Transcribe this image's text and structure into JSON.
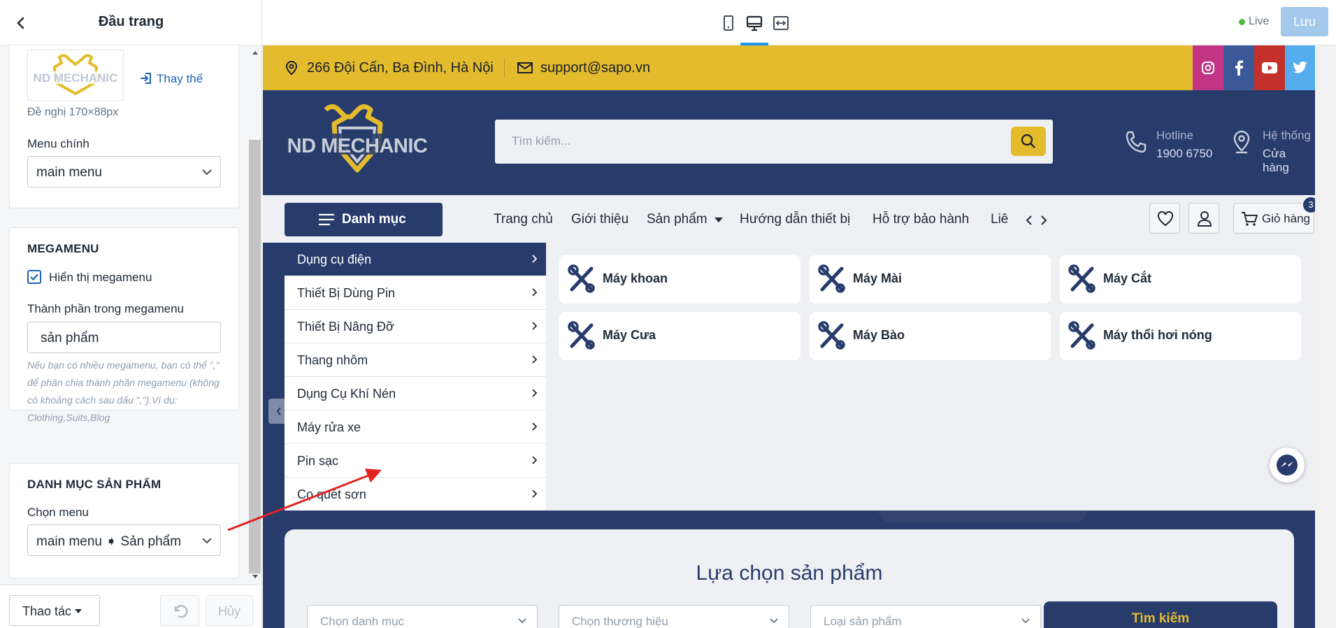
{
  "panel": {
    "title": "Đầu trang",
    "logo": {
      "replace_label": "Thay thế",
      "recommend": "Đề nghị 170×88px"
    },
    "main_menu": {
      "label": "Menu chính",
      "value": "main menu"
    },
    "megamenu": {
      "title": "MEGAMENU",
      "show_label": "Hiển thị megamenu",
      "show_checked": true,
      "components_label": "Thành phần trong megamenu",
      "components_value": "sản phẩm",
      "hint": "Nếu bạn có nhiều megamenu, bạn có thể \",\" để phân chia thành phần megamenu (không có khoảng cách sau dấu \",\").Ví dụ: Clothing,Suits,Blog"
    },
    "category": {
      "title": "DANH MỤC SẢN PHẨM",
      "menu_label": "Chọn menu",
      "menu_value": "main menu ➧ Sản phẩm"
    },
    "footer": {
      "actions": "Thao tác",
      "cancel": "Hủy"
    }
  },
  "toolbar": {
    "live": "Live",
    "save": "Lưu"
  },
  "site": {
    "logo_text": "ND MECHANIC",
    "address": "266 Đội Cấn, Ba Đình, Hà Nội",
    "email": "support@sapo.vn",
    "social": [
      "instagram-icon",
      "facebook-icon",
      "youtube-icon",
      "twitter-icon"
    ],
    "search_placeholder": "Tìm kiếm...",
    "hotline_label": "Hotline",
    "hotline_value": "1900 6750",
    "stores_label": "Hệ thống",
    "stores_value": "Cửa hàng",
    "category_button": "Danh mục",
    "nav": [
      "Trang chủ",
      "Giới thiệu",
      "Sản phẩm",
      "Hướng dẫn thiết bị",
      "Hỗ trợ bảo hành",
      "Liê"
    ],
    "cart_label": "Giỏ hàng",
    "cart_count": "3",
    "categories": [
      "Dụng cụ điện",
      "Thiết Bị Dùng Pin",
      "Thiết Bị Nâng Đỡ",
      "Thang nhôm",
      "Dụng Cụ Khí Nén",
      "Máy rửa xe",
      "Pin sạc",
      "Cọ quét sơn"
    ],
    "subcategories": [
      "Máy khoan",
      "Máy Mài",
      "Máy Cắt",
      "Máy Cưa",
      "Máy Bào",
      "Máy thổi hơi nóng"
    ],
    "product_finder": {
      "title": "Lựa chọn sản phẩm",
      "selects": [
        "Chọn danh mục",
        "Chọn thương hiệu",
        "Loại sản phẩm"
      ],
      "search": "Tìm kiếm"
    }
  },
  "colors": {
    "navy": "#283c6c",
    "gold": "#e3bb2d",
    "arrow": "#e32222"
  }
}
